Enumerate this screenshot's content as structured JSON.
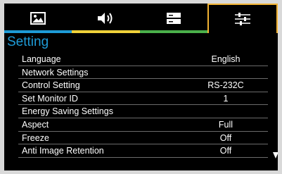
{
  "tabs": [
    {
      "name": "picture",
      "icon": "picture-icon",
      "color": "#1e9bd7"
    },
    {
      "name": "sound",
      "icon": "speaker-icon",
      "color": "#f0d23a"
    },
    {
      "name": "screen",
      "icon": "screen-icon",
      "color": "#4ab04a"
    },
    {
      "name": "setting",
      "icon": "sliders-icon",
      "color": "#f2b233",
      "active": true
    }
  ],
  "title": "Setting",
  "rows": [
    {
      "label": "Language",
      "value": "English"
    },
    {
      "label": "Network Settings",
      "value": ""
    },
    {
      "label": "Control Setting",
      "value": "RS-232C"
    },
    {
      "label": "Set Monitor ID",
      "value": "1"
    },
    {
      "label": "Energy Saving Settings",
      "value": ""
    },
    {
      "label": "Aspect",
      "value": "Full"
    },
    {
      "label": "Freeze",
      "value": "Off"
    },
    {
      "label": "Anti Image Retention",
      "value": "Off"
    }
  ],
  "scroll_indicator": "down-arrow"
}
